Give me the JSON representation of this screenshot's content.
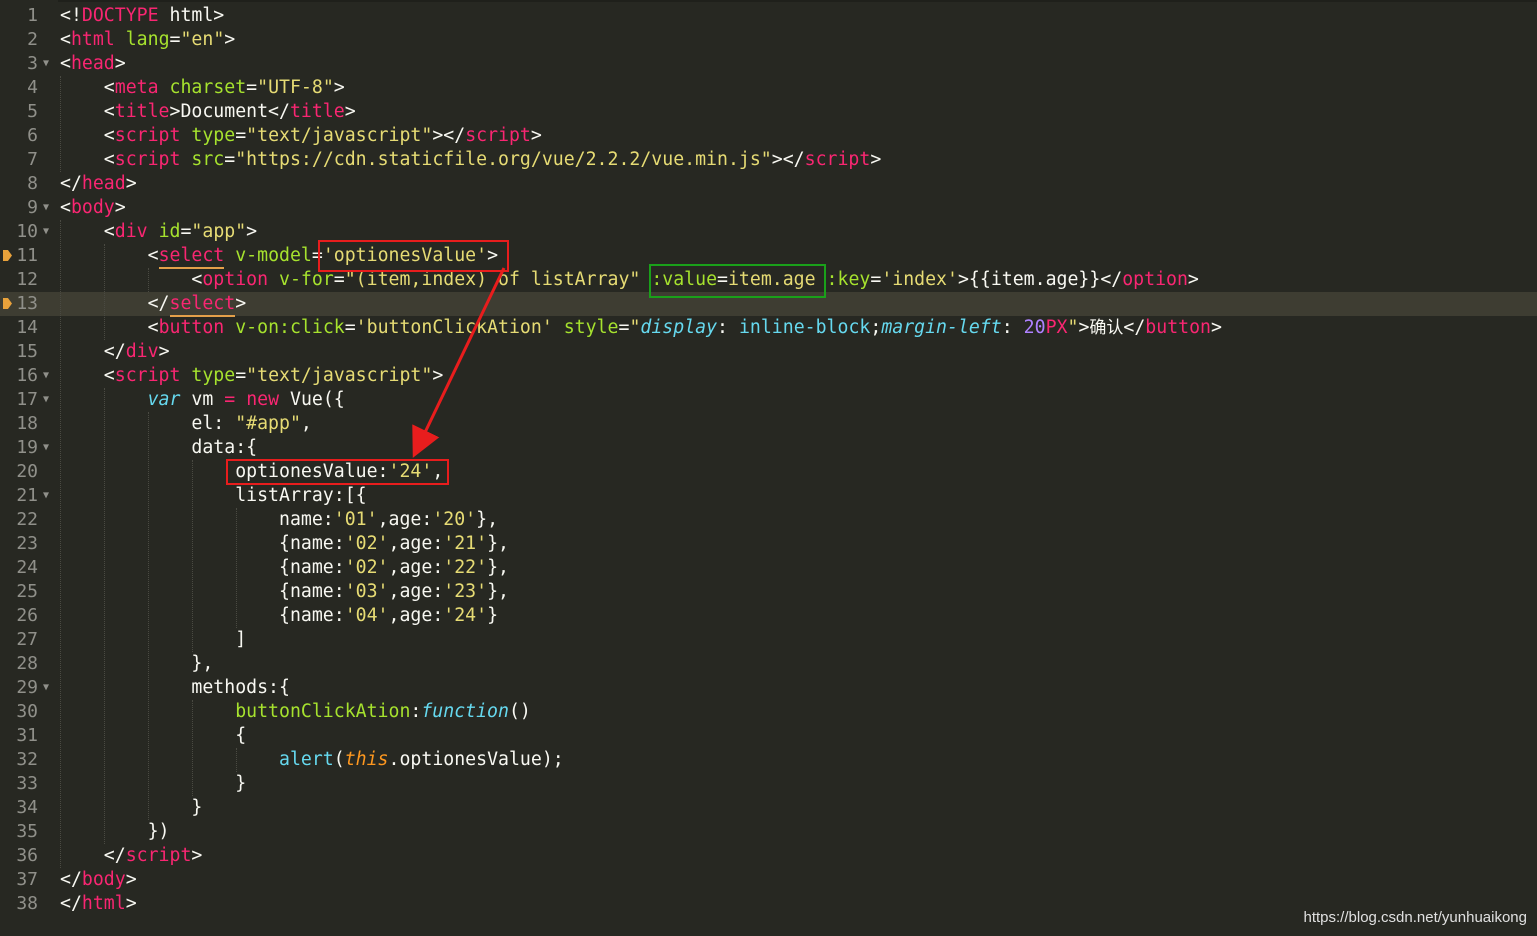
{
  "editor": {
    "colors": {
      "background": "#272822",
      "active_line": "#3e3d32",
      "annotation_red": "#e81d1d",
      "annotation_green": "#1aa01a",
      "bookmark": "#e9a23b"
    },
    "active_line": 13,
    "bookmarked_lines": [
      11,
      13
    ],
    "fold_lines": [
      3,
      9,
      10,
      16,
      17,
      19,
      21,
      29
    ],
    "lines": [
      {
        "n": "1",
        "tokens": [
          [
            "t-plain",
            "<!"
          ],
          [
            "t-tag",
            "DOCTYPE"
          ],
          [
            "t-plain",
            " html>"
          ]
        ]
      },
      {
        "n": "2",
        "tokens": [
          [
            "t-plain",
            "<"
          ],
          [
            "t-tag",
            "html"
          ],
          [
            "t-plain",
            " "
          ],
          [
            "t-attr",
            "lang"
          ],
          [
            "t-plain",
            "="
          ],
          [
            "t-str",
            "\"en\""
          ],
          [
            "t-plain",
            ">"
          ]
        ]
      },
      {
        "n": "3",
        "tokens": [
          [
            "t-plain",
            "<"
          ],
          [
            "t-tag",
            "head"
          ],
          [
            "t-plain",
            ">"
          ]
        ]
      },
      {
        "n": "4",
        "tokens": [
          [
            "t-plain",
            "    <"
          ],
          [
            "t-tag",
            "meta"
          ],
          [
            "t-plain",
            " "
          ],
          [
            "t-attr",
            "charset"
          ],
          [
            "t-plain",
            "="
          ],
          [
            "t-str",
            "\"UTF-8\""
          ],
          [
            "t-plain",
            ">"
          ]
        ]
      },
      {
        "n": "5",
        "tokens": [
          [
            "t-plain",
            "    <"
          ],
          [
            "t-tag",
            "title"
          ],
          [
            "t-plain",
            ">Document</"
          ],
          [
            "t-tag",
            "title"
          ],
          [
            "t-plain",
            ">"
          ]
        ]
      },
      {
        "n": "6",
        "tokens": [
          [
            "t-plain",
            "    <"
          ],
          [
            "t-tag",
            "script"
          ],
          [
            "t-plain",
            " "
          ],
          [
            "t-attr",
            "type"
          ],
          [
            "t-plain",
            "="
          ],
          [
            "t-str",
            "\"text/javascript\""
          ],
          [
            "t-plain",
            "></"
          ],
          [
            "t-tag",
            "script"
          ],
          [
            "t-plain",
            ">"
          ]
        ]
      },
      {
        "n": "7",
        "tokens": [
          [
            "t-plain",
            "    <"
          ],
          [
            "t-tag",
            "script"
          ],
          [
            "t-plain",
            " "
          ],
          [
            "t-attr",
            "src"
          ],
          [
            "t-plain",
            "="
          ],
          [
            "t-str",
            "\"https://cdn.staticfile.org/vue/2.2.2/vue.min.js\""
          ],
          [
            "t-plain",
            "></"
          ],
          [
            "t-tag",
            "script"
          ],
          [
            "t-plain",
            ">"
          ]
        ]
      },
      {
        "n": "8",
        "tokens": [
          [
            "t-plain",
            "</"
          ],
          [
            "t-tag",
            "head"
          ],
          [
            "t-plain",
            ">"
          ]
        ]
      },
      {
        "n": "9",
        "tokens": [
          [
            "t-plain",
            "<"
          ],
          [
            "t-tag",
            "body"
          ],
          [
            "t-plain",
            ">"
          ]
        ]
      },
      {
        "n": "10",
        "tokens": [
          [
            "t-plain",
            "    <"
          ],
          [
            "t-tag",
            "div"
          ],
          [
            "t-plain",
            " "
          ],
          [
            "t-attr",
            "id"
          ],
          [
            "t-plain",
            "="
          ],
          [
            "t-str",
            "\"app\""
          ],
          [
            "t-plain",
            ">"
          ]
        ]
      },
      {
        "n": "11",
        "tokens": [
          [
            "t-plain",
            "        <"
          ],
          [
            "t-tag",
            "select"
          ],
          [
            "t-plain",
            " "
          ],
          [
            "t-attr",
            "v-model"
          ],
          [
            "t-plain",
            "="
          ],
          [
            "t-str",
            "'optionesValue'"
          ],
          [
            "t-plain",
            ">"
          ]
        ]
      },
      {
        "n": "12",
        "tokens": [
          [
            "t-plain",
            "            <"
          ],
          [
            "t-tag",
            "option"
          ],
          [
            "t-plain",
            " "
          ],
          [
            "t-attr",
            "v-for"
          ],
          [
            "t-plain",
            "="
          ],
          [
            "t-str",
            "\"(item,index) of listArray\""
          ],
          [
            "t-plain",
            " "
          ],
          [
            "t-attr",
            ":value"
          ],
          [
            "t-plain",
            "="
          ],
          [
            "t-str",
            "item.age"
          ],
          [
            "t-plain",
            " "
          ],
          [
            "t-attr",
            ":key"
          ],
          [
            "t-plain",
            "="
          ],
          [
            "t-str",
            "'index'"
          ],
          [
            "t-plain",
            ">{{item.age}}</"
          ],
          [
            "t-tag",
            "option"
          ],
          [
            "t-plain",
            ">"
          ]
        ]
      },
      {
        "n": "13",
        "tokens": [
          [
            "t-plain",
            "        </"
          ],
          [
            "t-tag",
            "select"
          ],
          [
            "t-plain",
            ">"
          ]
        ]
      },
      {
        "n": "14",
        "tokens": [
          [
            "t-plain",
            "        <"
          ],
          [
            "t-tag",
            "button"
          ],
          [
            "t-plain",
            " "
          ],
          [
            "t-attr",
            "v-on:click"
          ],
          [
            "t-plain",
            "="
          ],
          [
            "t-str",
            "'buttonClickAtion'"
          ],
          [
            "t-plain",
            " "
          ],
          [
            "t-attr",
            "style"
          ],
          [
            "t-plain",
            "="
          ],
          [
            "t-str",
            "\""
          ],
          [
            "t-prop",
            "display"
          ],
          [
            "t-plain",
            ": "
          ],
          [
            "t-sup",
            "inline-block"
          ],
          [
            "t-plain",
            ";"
          ],
          [
            "t-prop",
            "margin-left"
          ],
          [
            "t-plain",
            ": "
          ],
          [
            "t-num",
            "20"
          ],
          [
            "t-kw",
            "PX"
          ],
          [
            "t-str",
            "\""
          ],
          [
            "t-plain",
            ">"
          ],
          [
            "t-cjk",
            "确认"
          ],
          [
            "t-plain",
            "</"
          ],
          [
            "t-tag",
            "button"
          ],
          [
            "t-plain",
            ">"
          ]
        ]
      },
      {
        "n": "15",
        "tokens": [
          [
            "t-plain",
            "    </"
          ],
          [
            "t-tag",
            "div"
          ],
          [
            "t-plain",
            ">"
          ]
        ]
      },
      {
        "n": "16",
        "tokens": [
          [
            "t-plain",
            "    <"
          ],
          [
            "t-tag",
            "script"
          ],
          [
            "t-plain",
            " "
          ],
          [
            "t-attr",
            "type"
          ],
          [
            "t-plain",
            "="
          ],
          [
            "t-str",
            "\"text/javascript\""
          ],
          [
            "t-plain",
            ">"
          ]
        ]
      },
      {
        "n": "17",
        "tokens": [
          [
            "t-plain",
            "        "
          ],
          [
            "t-sto",
            "var"
          ],
          [
            "t-plain",
            " vm "
          ],
          [
            "t-kw",
            "="
          ],
          [
            "t-plain",
            " "
          ],
          [
            "t-kw",
            "new"
          ],
          [
            "t-plain",
            " Vue({"
          ]
        ]
      },
      {
        "n": "18",
        "tokens": [
          [
            "t-plain",
            "            el: "
          ],
          [
            "t-str",
            "\"#app\""
          ],
          [
            "t-plain",
            ","
          ]
        ]
      },
      {
        "n": "19",
        "tokens": [
          [
            "t-plain",
            "            data:{"
          ]
        ]
      },
      {
        "n": "20",
        "tokens": [
          [
            "t-plain",
            "                optionesValue:"
          ],
          [
            "t-str",
            "'24'"
          ],
          [
            "t-plain",
            ","
          ]
        ]
      },
      {
        "n": "21",
        "tokens": [
          [
            "t-plain",
            "                listArray:[{"
          ]
        ]
      },
      {
        "n": "22",
        "tokens": [
          [
            "t-plain",
            "                    name:"
          ],
          [
            "t-str",
            "'01'"
          ],
          [
            "t-plain",
            ",age:"
          ],
          [
            "t-str",
            "'20'"
          ],
          [
            "t-plain",
            "},"
          ]
        ]
      },
      {
        "n": "23",
        "tokens": [
          [
            "t-plain",
            "                    {name:"
          ],
          [
            "t-str",
            "'02'"
          ],
          [
            "t-plain",
            ",age:"
          ],
          [
            "t-str",
            "'21'"
          ],
          [
            "t-plain",
            "},"
          ]
        ]
      },
      {
        "n": "24",
        "tokens": [
          [
            "t-plain",
            "                    {name:"
          ],
          [
            "t-str",
            "'02'"
          ],
          [
            "t-plain",
            ",age:"
          ],
          [
            "t-str",
            "'22'"
          ],
          [
            "t-plain",
            "},"
          ]
        ]
      },
      {
        "n": "25",
        "tokens": [
          [
            "t-plain",
            "                    {name:"
          ],
          [
            "t-str",
            "'03'"
          ],
          [
            "t-plain",
            ",age:"
          ],
          [
            "t-str",
            "'23'"
          ],
          [
            "t-plain",
            "},"
          ]
        ]
      },
      {
        "n": "26",
        "tokens": [
          [
            "t-plain",
            "                    {name:"
          ],
          [
            "t-str",
            "'04'"
          ],
          [
            "t-plain",
            ",age:"
          ],
          [
            "t-str",
            "'24'"
          ],
          [
            "t-plain",
            "}"
          ]
        ]
      },
      {
        "n": "27",
        "tokens": [
          [
            "t-plain",
            "                ]"
          ]
        ]
      },
      {
        "n": "28",
        "tokens": [
          [
            "t-plain",
            "            },"
          ]
        ]
      },
      {
        "n": "29",
        "tokens": [
          [
            "t-plain",
            "            methods:{"
          ]
        ]
      },
      {
        "n": "30",
        "tokens": [
          [
            "t-plain",
            "                "
          ],
          [
            "t-fn",
            "buttonClickAtion"
          ],
          [
            "t-plain",
            ":"
          ],
          [
            "t-sto",
            "function"
          ],
          [
            "t-plain",
            "()"
          ]
        ]
      },
      {
        "n": "31",
        "tokens": [
          [
            "t-plain",
            "                {"
          ]
        ]
      },
      {
        "n": "32",
        "tokens": [
          [
            "t-plain",
            "                    "
          ],
          [
            "t-sup",
            "alert"
          ],
          [
            "t-plain",
            "("
          ],
          [
            "t-this",
            "this"
          ],
          [
            "t-plain",
            ".optionesValue);"
          ]
        ]
      },
      {
        "n": "33",
        "tokens": [
          [
            "t-plain",
            "                }"
          ]
        ]
      },
      {
        "n": "34",
        "tokens": [
          [
            "t-plain",
            "            }"
          ]
        ]
      },
      {
        "n": "35",
        "tokens": [
          [
            "t-plain",
            "        })"
          ]
        ]
      },
      {
        "n": "36",
        "tokens": [
          [
            "t-plain",
            "    </"
          ],
          [
            "t-tag",
            "script"
          ],
          [
            "t-plain",
            ">"
          ]
        ]
      },
      {
        "n": "37",
        "tokens": [
          [
            "t-plain",
            "</"
          ],
          [
            "t-tag",
            "body"
          ],
          [
            "t-plain",
            ">"
          ]
        ]
      },
      {
        "n": "38",
        "tokens": [
          [
            "t-plain",
            "</"
          ],
          [
            "t-tag",
            "html"
          ],
          [
            "t-plain",
            ">"
          ]
        ]
      }
    ]
  },
  "watermark": "https://blog.csdn.net/yunhuaikong"
}
